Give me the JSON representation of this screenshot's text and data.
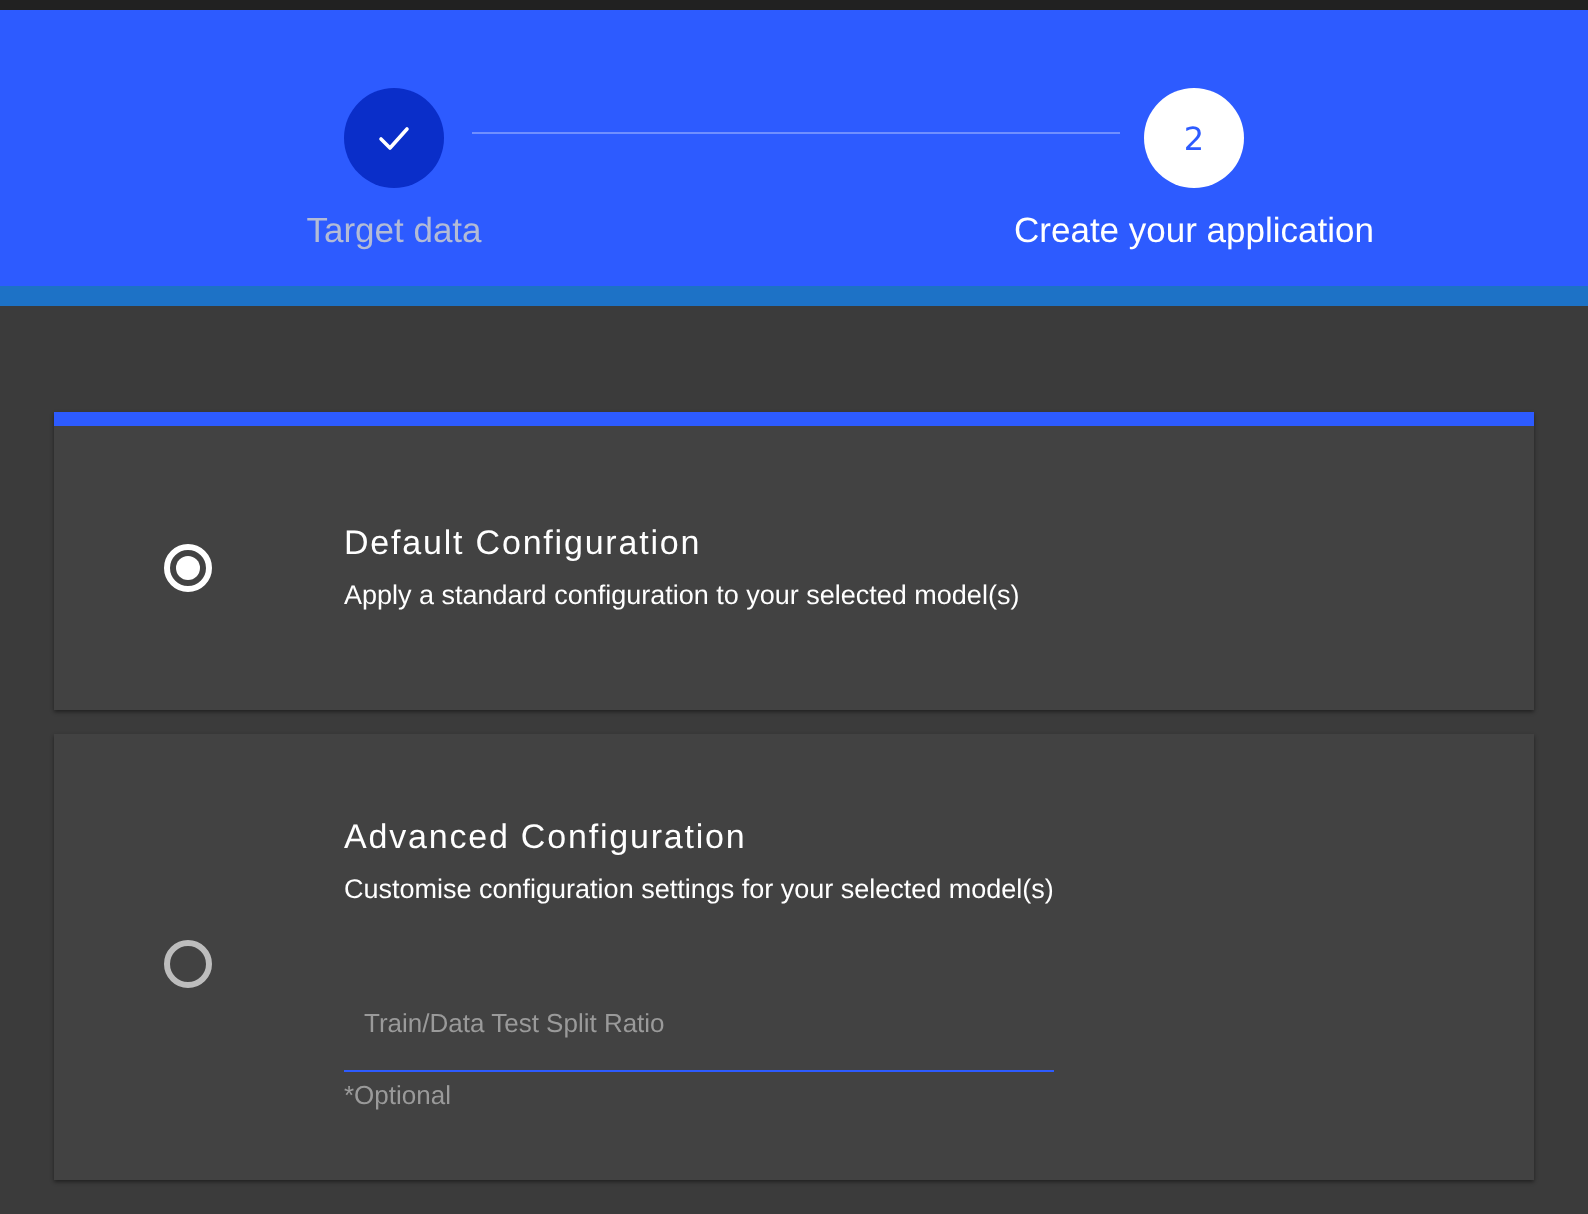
{
  "stepper": {
    "steps": [
      {
        "label": "Target data",
        "completed": true,
        "active": false
      },
      {
        "label": "Create your application",
        "number": "2",
        "completed": false,
        "active": true
      }
    ]
  },
  "options": [
    {
      "title": "Default Configuration",
      "description": "Apply a standard configuration to your selected model(s)",
      "selected": true
    },
    {
      "title": "Advanced Configuration",
      "description": "Customise configuration settings for your selected model(s)",
      "selected": false,
      "field": {
        "placeholder": "Train/Data Test Split Ratio",
        "helper": "*Optional"
      }
    }
  ]
}
